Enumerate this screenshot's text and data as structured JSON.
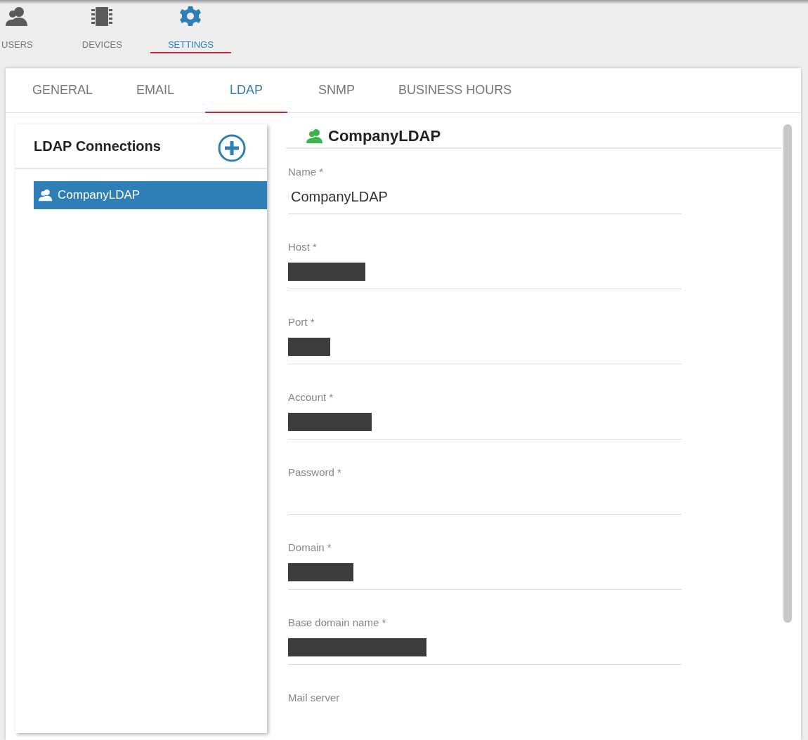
{
  "nav": [
    {
      "label": "USERS",
      "selected": false
    },
    {
      "label": "DEVICES",
      "selected": false
    },
    {
      "label": "SETTINGS",
      "selected": true
    }
  ],
  "tabs": [
    {
      "label": "GENERAL",
      "selected": false
    },
    {
      "label": "EMAIL",
      "selected": false
    },
    {
      "label": "LDAP",
      "selected": true
    },
    {
      "label": "SNMP",
      "selected": false
    },
    {
      "label": "BUSINESS HOURS",
      "selected": false
    }
  ],
  "connections": {
    "title": "LDAP Connections",
    "items": [
      {
        "label": "CompanyLDAP",
        "selected": true
      }
    ]
  },
  "detail": {
    "title": "CompanyLDAP",
    "fields": [
      {
        "label": "Name *",
        "value": "CompanyLDAP",
        "redacted": false
      },
      {
        "label": "Host *",
        "redacted": true
      },
      {
        "label": "Port *",
        "redacted": true
      },
      {
        "label": "Account *",
        "redacted": true
      },
      {
        "label": "Password *",
        "redacted": false
      },
      {
        "label": "Domain *",
        "redacted": true
      },
      {
        "label": "Base domain name *",
        "redacted": true
      },
      {
        "label": "Mail server"
      }
    ]
  }
}
